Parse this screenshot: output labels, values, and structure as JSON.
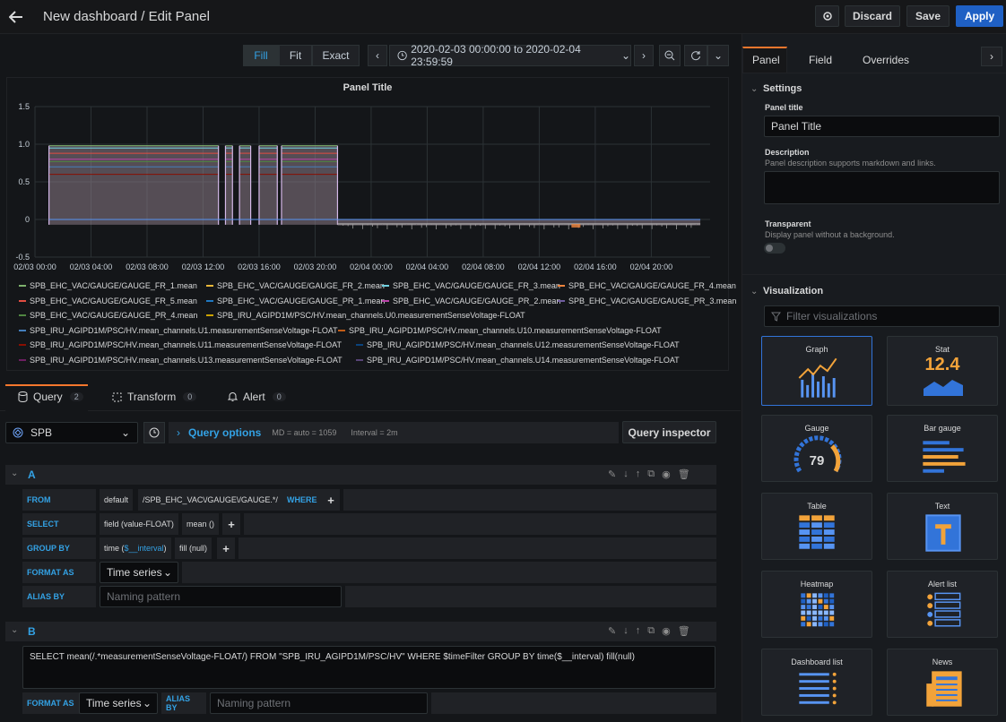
{
  "header": {
    "title": "New dashboard / Edit Panel",
    "discard": "Discard",
    "save": "Save",
    "apply": "Apply"
  },
  "toolbar": {
    "fill": "Fill",
    "fit": "Fit",
    "exact": "Exact",
    "time_range": "2020-02-03 00:00:00 to 2020-02-04 23:59:59"
  },
  "chart_data": {
    "type": "line",
    "title": "Panel Title",
    "ylim": [
      -0.5,
      1.5
    ],
    "yticks": [
      "1.5",
      "1.0",
      "0.5",
      "0",
      "-0.5"
    ],
    "xticks": [
      "02/03 00:00",
      "02/03 04:00",
      "02/03 08:00",
      "02/03 12:00",
      "02/03 16:00",
      "02/03 20:00",
      "02/04 00:00",
      "02/04 04:00",
      "02/04 08:00",
      "02/04 12:00",
      "02/04 16:00",
      "02/04 20:00"
    ],
    "legend": [
      {
        "name": "SPB_EHC_VAC/GAUGE/GAUGE_FR_1.mean",
        "color": "#7eb26d"
      },
      {
        "name": "SPB_EHC_VAC/GAUGE/GAUGE_FR_2.mean",
        "color": "#eab839"
      },
      {
        "name": "SPB_EHC_VAC/GAUGE/GAUGE_FR_3.mean",
        "color": "#6ed0e0"
      },
      {
        "name": "SPB_EHC_VAC/GAUGE/GAUGE_FR_4.mean",
        "color": "#ef843c"
      },
      {
        "name": "SPB_EHC_VAC/GAUGE/GAUGE_FR_5.mean",
        "color": "#e24d42"
      },
      {
        "name": "SPB_EHC_VAC/GAUGE/GAUGE_PR_1.mean",
        "color": "#1f78c1"
      },
      {
        "name": "SPB_EHC_VAC/GAUGE/GAUGE_PR_2.mean",
        "color": "#ba43a9"
      },
      {
        "name": "SPB_EHC_VAC/GAUGE/GAUGE_PR_3.mean",
        "color": "#705da0"
      },
      {
        "name": "SPB_EHC_VAC/GAUGE/GAUGE_PR_4.mean",
        "color": "#508642"
      },
      {
        "name": "SPB_IRU_AGIPD1M/PSC/HV.mean_channels.U0.measurementSenseVoltage-FLOAT",
        "color": "#cca300"
      },
      {
        "name": "SPB_IRU_AGIPD1M/PSC/HV.mean_channels.U1.measurementSenseVoltage-FLOAT",
        "color": "#447ebc"
      },
      {
        "name": "SPB_IRU_AGIPD1M/PSC/HV.mean_channels.U10.measurementSenseVoltage-FLOAT",
        "color": "#c15c17"
      },
      {
        "name": "SPB_IRU_AGIPD1M/PSC/HV.mean_channels.U11.measurementSenseVoltage-FLOAT",
        "color": "#890f02"
      },
      {
        "name": "SPB_IRU_AGIPD1M/PSC/HV.mean_channels.U12.measurementSenseVoltage-FLOAT",
        "color": "#0a437c"
      },
      {
        "name": "SPB_IRU_AGIPD1M/PSC/HV.mean_channels.U13.measurementSenseVoltage-FLOAT",
        "color": "#6d1f62"
      },
      {
        "name": "SPB_IRU_AGIPD1M/PSC/HV.mean_channels.U14.measurementSenseVoltage-FLOAT",
        "color": "#584477"
      }
    ]
  },
  "query_tabs": [
    {
      "label": "Query",
      "count": "2"
    },
    {
      "label": "Transform",
      "count": "0"
    },
    {
      "label": "Alert",
      "count": "0"
    }
  ],
  "datasource": {
    "name": "SPB",
    "query_options": "Query options",
    "md": "MD = auto = 1059",
    "interval": "Interval = 2m",
    "inspector": "Query inspector"
  },
  "query_a": {
    "letter": "A",
    "from_label": "FROM",
    "from_policy": "default",
    "from_measurement": "/SPB_EHC_VAC\\/GAUGE\\/GAUGE.*/",
    "where_label": "WHERE",
    "select_label": "SELECT",
    "select_field": "field (value-FLOAT)",
    "select_fn": "mean ()",
    "group_label": "GROUP BY",
    "group_time_prefix": "time (",
    "group_time_var": "$__interval",
    "group_time_suffix": ")",
    "group_fill": "fill (null)",
    "format_label": "FORMAT AS",
    "format_value": "Time series",
    "alias_label": "ALIAS BY",
    "alias_placeholder": "Naming pattern"
  },
  "query_b": {
    "letter": "B",
    "raw": "SELECT mean(/.*measurementSenseVoltage-FLOAT/) FROM \"SPB_IRU_AGIPD1M/PSC/HV\" WHERE $timeFilter GROUP BY time($__interval) fill(null)",
    "format_label": "FORMAT AS",
    "format_value": "Time series",
    "alias_label": "ALIAS BY",
    "alias_placeholder": "Naming pattern"
  },
  "sidebar": {
    "tabs": [
      "Panel",
      "Field",
      "Overrides"
    ],
    "settings_title": "Settings",
    "panel_title_label": "Panel title",
    "panel_title_value": "Panel Title",
    "description_label": "Description",
    "description_hint": "Panel description supports markdown and links.",
    "transparent_label": "Transparent",
    "transparent_hint": "Display panel without a background.",
    "viz_title": "Visualization",
    "viz_filter_placeholder": "Filter visualizations",
    "viz": [
      "Graph",
      "Stat",
      "Gauge",
      "Bar gauge",
      "Table",
      "Text",
      "Heatmap",
      "Alert list",
      "Dashboard list",
      "News"
    ],
    "stat_value": "12.4",
    "gauge_value": "79"
  }
}
